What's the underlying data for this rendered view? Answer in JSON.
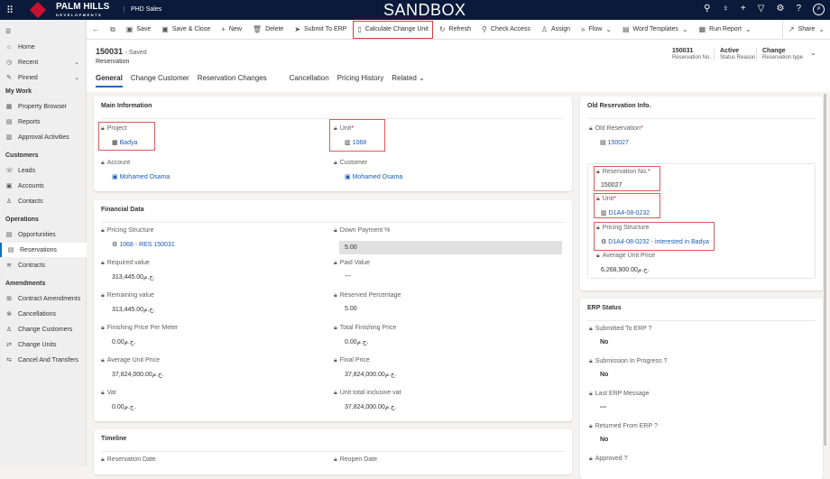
{
  "topbar": {
    "brand": "PALM HILLS",
    "brand_sub": "DEVELOPMENTS",
    "app": "PHD Sales",
    "env": "SANDBOX",
    "avatar": "#"
  },
  "sidebar": {
    "items": [
      {
        "label": "Home",
        "icon": "home-icon",
        "g": "⌂"
      },
      {
        "label": "Recent",
        "icon": "clock-icon",
        "g": "◷"
      },
      {
        "label": "Pinned",
        "icon": "pin-icon",
        "g": "✎"
      }
    ],
    "sections": [
      {
        "title": "My Work",
        "items": [
          {
            "label": "Property Browser",
            "g": "▦"
          },
          {
            "label": "Reports",
            "g": "▤"
          },
          {
            "label": "Approval Activities",
            "g": "▥"
          }
        ]
      },
      {
        "title": "Customers",
        "items": [
          {
            "label": "Leads",
            "g": "☏"
          },
          {
            "label": "Accounts",
            "g": "▣"
          },
          {
            "label": "Contacts",
            "g": "♙"
          }
        ]
      },
      {
        "title": "Operations",
        "items": [
          {
            "label": "Opportunities",
            "g": "▤"
          },
          {
            "label": "Reservations",
            "g": "▤"
          },
          {
            "label": "Contracts",
            "g": "≋"
          }
        ]
      },
      {
        "title": "Amendments",
        "items": [
          {
            "label": "Contract Amendments",
            "g": "⊞"
          },
          {
            "label": "Cancellations",
            "g": "⊗"
          },
          {
            "label": "Change Customers",
            "g": "♙"
          },
          {
            "label": "Change Units",
            "g": "⇄"
          },
          {
            "label": "Cancel And Transfers",
            "g": "⇆"
          }
        ]
      }
    ]
  },
  "commands": [
    {
      "label": "Save",
      "g": "▣"
    },
    {
      "label": "Save & Close",
      "g": "▣"
    },
    {
      "label": "New",
      "g": "+"
    },
    {
      "label": "Delete",
      "g": "🗑"
    },
    {
      "label": "Submit To ERP",
      "g": "➤"
    },
    {
      "label": "Calculate Change Unit",
      "g": "▯"
    },
    {
      "label": "Refresh",
      "g": "↻"
    },
    {
      "label": "Check Access",
      "g": "⚲"
    },
    {
      "label": "Assign",
      "g": "♙"
    },
    {
      "label": "Flow",
      "g": "»"
    },
    {
      "label": "Word Templates",
      "g": "▤"
    },
    {
      "label": "Run Report",
      "g": "▦"
    },
    {
      "label": "Share",
      "g": "↗"
    }
  ],
  "header": {
    "id": "150031",
    "saved": "- Saved",
    "entity": "Reservation",
    "fields": [
      {
        "value": "150031",
        "label": "Reservation No."
      },
      {
        "value": "Active",
        "label": "Status Reason"
      },
      {
        "value": "Change",
        "label": "Reservation type"
      }
    ],
    "tabs": [
      "General",
      "Change Customer",
      "Reservation Changes",
      "Cancellation",
      "Pricing History",
      "Related"
    ]
  },
  "main_info": {
    "title": "Main Information",
    "project_label": "Project",
    "project": "Badya",
    "unit_label": "Unit",
    "unit": "1068",
    "account_label": "Account",
    "account": "Mohamed Osama",
    "customer_label": "Customer",
    "customer": "Mohamed Osama"
  },
  "financial": {
    "title": "Financial Data",
    "left": [
      {
        "label": "Pricing Structure",
        "value": "1068 - RES 150031"
      },
      {
        "label": "Required value",
        "value": "313,445.00ج.م."
      },
      {
        "label": "Remaining value",
        "value": "313,445.00ج.م."
      },
      {
        "label": "Finishing Price Per Meter",
        "value": "0.00ج.م."
      },
      {
        "label": "Average Unit Price",
        "value": "37,824,000.00ج.م."
      },
      {
        "label": "Vat",
        "value": "0.00ج.م."
      }
    ],
    "right": [
      {
        "label": "Down Payment %",
        "value": "5.00"
      },
      {
        "label": "Paid Value",
        "value": "---"
      },
      {
        "label": "Reserved Percentage",
        "value": "5.00"
      },
      {
        "label": "Total Finishing Price",
        "value": "0.00ج.م."
      },
      {
        "label": "Final Price",
        "value": "37,824,000.00ج.م."
      },
      {
        "label": "Unit total inclusive vat",
        "value": "37,824,000.00ج.م."
      }
    ]
  },
  "timeline": {
    "title": "Timeline",
    "left_label": "Reservation Date",
    "right_label": "Reopen Date"
  },
  "old_reservation": {
    "title": "Old Reservation Info.",
    "old_label": "Old Reservation",
    "old": "150027",
    "resno_label": "Reservation No.",
    "resno": "150027",
    "unit_label": "Unit",
    "unit": "D1A4-08-0232",
    "ps_label": "Pricing Structure",
    "ps": "D1A4-08-0232 - interested in Badya",
    "avg_label": "Average Unit Price",
    "avg": "6,268,900.00ج.م."
  },
  "erp": {
    "title": "ERP Status",
    "fields": [
      {
        "label": "Submitted To ERP ?",
        "value": "No"
      },
      {
        "label": "Submission In Progress ?",
        "value": "No"
      },
      {
        "label": "Last ERP Message",
        "value": "---"
      },
      {
        "label": "Returned From ERP ?",
        "value": "No"
      },
      {
        "label": "Approved ?",
        "value": ""
      }
    ]
  }
}
